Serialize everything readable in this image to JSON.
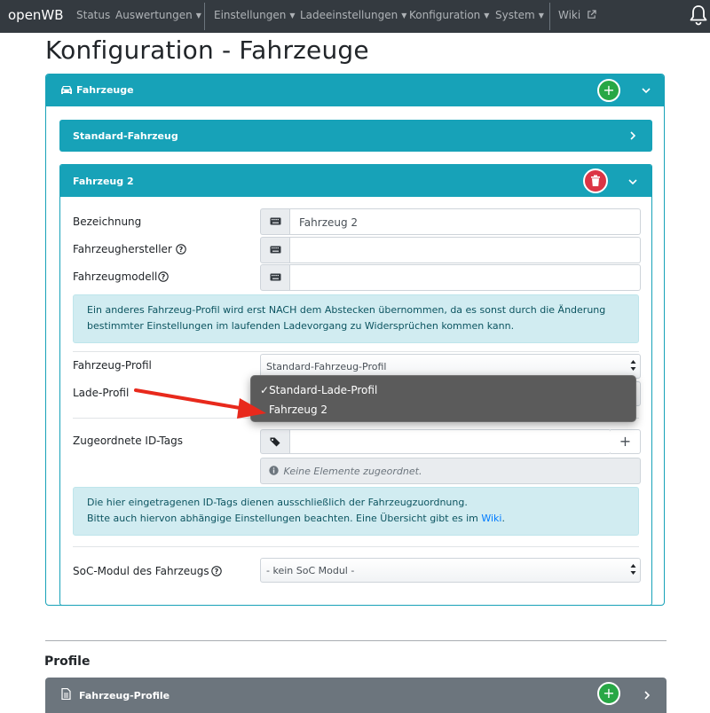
{
  "navbar": {
    "brand": "openWB",
    "items": [
      {
        "label": "Status",
        "caret": false
      },
      {
        "label": "Auswertungen",
        "caret": true
      },
      {
        "label": "Einstellungen",
        "caret": true
      },
      {
        "label": "Ladeeinstellungen",
        "caret": true
      },
      {
        "label": "Konfiguration",
        "caret": true
      },
      {
        "label": "System",
        "caret": true
      },
      {
        "label": "Wiki",
        "caret": false
      }
    ],
    "icons": [
      "external-link-icon",
      "bell-icon"
    ]
  },
  "page_title": "Konfiguration - Fahrzeuge",
  "vehicles_card": {
    "title": "Fahrzeuge",
    "add_button": "+",
    "standard_vehicle": {
      "title": "Standard-Fahrzeug"
    },
    "vehicle2": {
      "title": "Fahrzeug 2",
      "fields": {
        "name_label": "Bezeichnung",
        "name_value": "Fahrzeug 2",
        "manufacturer_label": "Fahrzeughersteller",
        "manufacturer_value": "",
        "model_label": "Fahrzeugmodell",
        "model_value": ""
      },
      "profile_info": "Ein anderes Fahrzeug-Profil wird erst NACH dem Abstecken übernommen, da es sonst durch die Änderung bestimmter Einstellungen im laufenden Ladevorgang zu Widersprüchen kommen kann.",
      "vehicle_profile_label": "Fahrzeug-Profil",
      "vehicle_profile_value": "Standard-Fahrzeug-Profil",
      "charge_profile_label": "Lade-Profil",
      "charge_profile_options": [
        {
          "label": "Standard-Lade-Profil",
          "checked": true
        },
        {
          "label": "Fahrzeug 2",
          "checked": false
        }
      ],
      "check_mark": "✓",
      "id_tags_label": "Zugeordnete ID-Tags",
      "id_tags_add": "+",
      "id_tags_empty": "Keine Elemente zugeordnet.",
      "id_tags_info_line1": "Die hier eingetragenen ID-Tags dienen ausschließlich der Fahrzeugzuordnung.",
      "id_tags_info_line2": "Bitte auch hiervon abhängige Einstellungen beachten. Eine Übersicht gibt es im",
      "id_tags_info_link": "Wiki",
      "id_tags_info_end": ".",
      "soc_label": "SoC-Modul des Fahrzeugs",
      "soc_value": "- kein SoC Modul -"
    }
  },
  "profiles": {
    "heading": "Profile",
    "vehicle_profiles_title": "Fahrzeug-Profile",
    "add_button": "+"
  },
  "colors": {
    "teal": "#17a2b8",
    "navbar": "#343a40",
    "success": "#28a745",
    "danger": "#dc3545",
    "annotation_arrow": "#e8291c"
  }
}
